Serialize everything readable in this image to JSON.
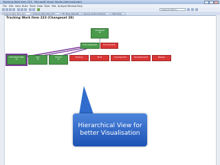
{
  "window": {
    "title": "Tracking Work Item 223 - Microsoft Visual Studio (Administrator)"
  },
  "menubar": {
    "items": [
      "File",
      "Edit",
      "View",
      "Build",
      "Team",
      "Data",
      "Tools",
      "Test",
      "Analyze",
      "Window",
      "Help"
    ]
  },
  "toolbar": {
    "search_placeholder": "<Search Work>"
  },
  "tabs": [
    {
      "label": "Tracking Work Item 223",
      "active": true
    },
    {
      "label": "Tracking Work Item 223",
      "active": false
    },
    {
      "label": "My Bugs [Results]",
      "active": false
    },
    {
      "label": "Source Control Explorer",
      "active": false
    },
    {
      "label": "Start Page",
      "active": false
    }
  ],
  "document": {
    "title": "Tracking Work Item 223 (Changeset 28)"
  },
  "tree": {
    "nodes": [
      {
        "id": "root",
        "label": "Changeset",
        "sub": "28",
        "color": "green"
      },
      {
        "id": "middle",
        "label": "Fixed Integration",
        "sub": "",
        "color": "green"
      },
      {
        "id": "mid-right",
        "label": "Fix Production",
        "sub": "",
        "color": "red"
      },
      {
        "id": "leaf-1",
        "label": "Initial Build Data",
        "sub": "26",
        "color": "green",
        "highlight": true
      },
      {
        "id": "leaf-2",
        "label": "Dev",
        "sub": "26",
        "color": "green"
      },
      {
        "id": "leaf-3",
        "label": "Rollout",
        "sub": "26",
        "color": "green"
      },
      {
        "id": "leaf-4",
        "label": "Tracking",
        "sub": "",
        "color": "red"
      },
      {
        "id": "leaf-5",
        "label": "Build",
        "sub": "",
        "color": "red"
      },
      {
        "id": "leaf-6",
        "label": "Development",
        "sub": "",
        "color": "red"
      },
      {
        "id": "leaf-7",
        "label": "Development/3",
        "sub": "",
        "color": "red"
      },
      {
        "id": "leaf-8",
        "label": "Release",
        "sub": "",
        "color": "red"
      }
    ]
  },
  "callout": {
    "line1": "Hierarchical View for",
    "line2": "better Visualisation"
  },
  "colors": {
    "node_green": "#4a9a4c",
    "node_red": "#d93636",
    "highlight_purple": "#7a3a9a",
    "callout_blue": "#2f6ccc"
  }
}
